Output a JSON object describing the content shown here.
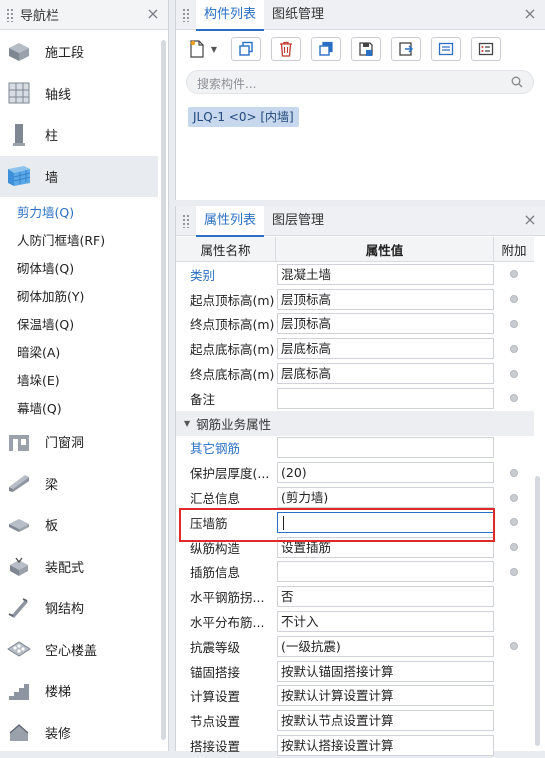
{
  "nav": {
    "title": "导航栏",
    "items_top": [
      {
        "label": "施工段",
        "icon": "construction-segment-icon"
      },
      {
        "label": "轴线",
        "icon": "grid-axis-icon"
      },
      {
        "label": "柱",
        "icon": "column-icon"
      },
      {
        "label": "墙",
        "icon": "wall-icon",
        "active": true
      }
    ],
    "sub_items": [
      {
        "label": "剪力墙(Q)",
        "active": true
      },
      {
        "label": "人防门框墙(RF)"
      },
      {
        "label": "砌体墙(Q)"
      },
      {
        "label": "砌体加筋(Y)"
      },
      {
        "label": "保温墙(Q)"
      },
      {
        "label": "暗梁(A)"
      },
      {
        "label": "墙垛(E)"
      },
      {
        "label": "幕墙(Q)"
      }
    ],
    "items_bottom": [
      {
        "label": "门窗洞",
        "icon": "door-window-icon"
      },
      {
        "label": "梁",
        "icon": "beam-icon"
      },
      {
        "label": "板",
        "icon": "slab-icon"
      },
      {
        "label": "装配式",
        "icon": "prefab-icon"
      },
      {
        "label": "钢结构",
        "icon": "steel-structure-icon"
      },
      {
        "label": "空心楼盖",
        "icon": "hollow-floor-icon"
      },
      {
        "label": "楼梯",
        "icon": "stairs-icon"
      },
      {
        "label": "装修",
        "icon": "decoration-icon"
      }
    ]
  },
  "components": {
    "tabs": [
      "构件列表",
      "图纸管理"
    ],
    "search_placeholder": "搜索构件...",
    "item": "JLQ-1 <0> [内墙]"
  },
  "properties": {
    "tabs": [
      "属性列表",
      "图层管理"
    ],
    "headers": [
      "属性名称",
      "属性值",
      "附加"
    ],
    "rows": [
      {
        "name": "类别",
        "value": "混凝土墙",
        "link": true,
        "dot": true
      },
      {
        "name": "起点顶标高(m)",
        "value": "层顶标高",
        "dot": true
      },
      {
        "name": "终点顶标高(m)",
        "value": "层顶标高",
        "dot": true
      },
      {
        "name": "起点底标高(m)",
        "value": "层底标高",
        "dot": true
      },
      {
        "name": "终点底标高(m)",
        "value": "层底标高",
        "dot": true
      },
      {
        "name": "备注",
        "value": "",
        "dot": true
      }
    ],
    "group_label": "钢筋业务属性",
    "group_rows": [
      {
        "name": "其它钢筋",
        "value": "",
        "link": true,
        "dot": false
      },
      {
        "name": "保护层厚度(...",
        "value": "(20)",
        "dot": true
      },
      {
        "name": "汇总信息",
        "value": "(剪力墙)",
        "dot": true
      },
      {
        "name": "压墙筋",
        "value": "",
        "dot": true,
        "editing": true
      },
      {
        "name": "纵筋构造",
        "value": "设置插筋",
        "dot": true
      },
      {
        "name": "插筋信息",
        "value": "",
        "dot": true
      },
      {
        "name": "水平钢筋拐...",
        "value": "否",
        "dot": false
      },
      {
        "name": "水平分布筋...",
        "value": "不计入",
        "dot": false
      },
      {
        "name": "抗震等级",
        "value": "(一级抗震)",
        "dot": true
      },
      {
        "name": "锚固搭接",
        "value": "按默认锚固搭接计算",
        "dot": false
      },
      {
        "name": "计算设置",
        "value": "按默认计算设置计算",
        "dot": false
      },
      {
        "name": "节点设置",
        "value": "按默认节点设置计算",
        "dot": false
      },
      {
        "name": "搭接设置",
        "value": "按默认搭接设置计算",
        "dot": false
      }
    ]
  }
}
